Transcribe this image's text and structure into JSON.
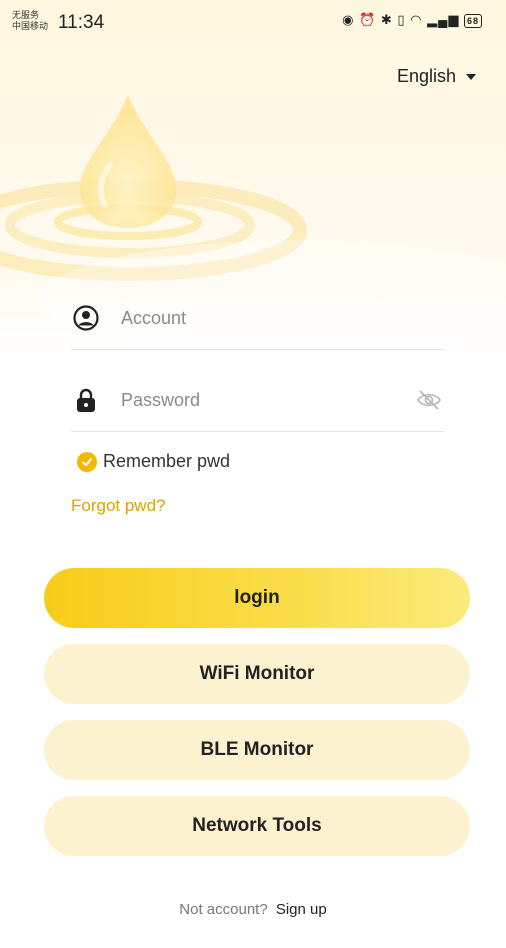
{
  "status_bar": {
    "carrier_line1": "无服务",
    "carrier_line2": "中国移动",
    "time": "11:34",
    "battery": "68"
  },
  "language": {
    "selected": "English"
  },
  "form": {
    "account_placeholder": "Account",
    "password_placeholder": "Password",
    "remember_label": "Remember pwd",
    "remember_checked": true,
    "forgot_label": "Forgot pwd?"
  },
  "buttons": {
    "login": "login",
    "wifi_monitor": "WiFi Monitor",
    "ble_monitor": "BLE Monitor",
    "network_tools": "Network Tools"
  },
  "footer": {
    "prompt": "Not account?",
    "signup": "Sign up"
  },
  "colors": {
    "accent": "#f1b800",
    "login_gradient_start": "#f8cc1a",
    "soft_button": "#fdf2cf",
    "link": "#e0a100"
  }
}
